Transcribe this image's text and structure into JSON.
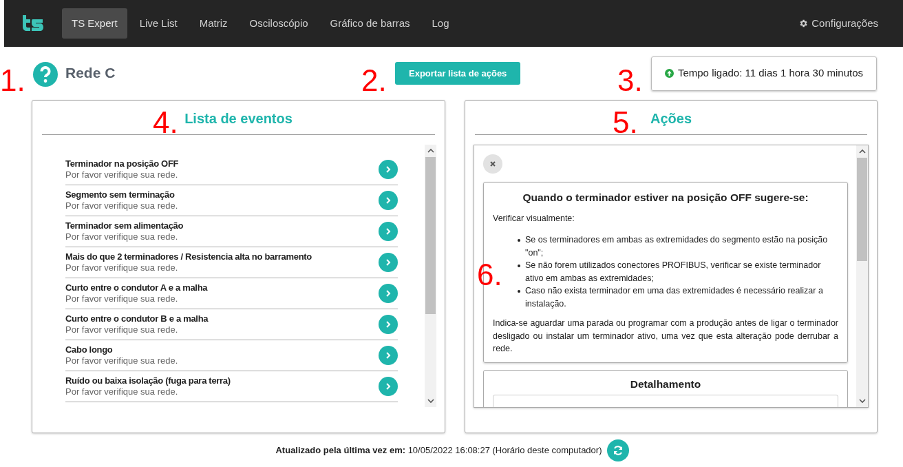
{
  "nav": {
    "items": [
      {
        "label": "TS Expert",
        "selected": true
      },
      {
        "label": "Live List",
        "selected": false
      },
      {
        "label": "Matriz",
        "selected": false
      },
      {
        "label": "Osciloscópio",
        "selected": false
      },
      {
        "label": "Gráfico de barras",
        "selected": false
      },
      {
        "label": "Log",
        "selected": false
      }
    ],
    "settings": "Configurações"
  },
  "network": {
    "annotation": "1.",
    "name": "Rede C"
  },
  "export": {
    "annotation": "2.",
    "label": "Exportar lista de ações"
  },
  "uptime": {
    "annotation": "3.",
    "text": "Tempo ligado: 11 dias 1 hora 30 minutos"
  },
  "events_panel": {
    "annotation": "4.",
    "title": "Lista de eventos",
    "events": [
      {
        "title": "Terminador na posição OFF",
        "subtitle": "Por favor verifique sua rede."
      },
      {
        "title": "Segmento sem terminação",
        "subtitle": "Por favor verifique sua rede."
      },
      {
        "title": "Terminador sem alimentação",
        "subtitle": "Por favor verifique sua rede."
      },
      {
        "title": "Mais do que 2 terminadores / Resistencia alta no barramento",
        "subtitle": "Por favor verifique sua rede."
      },
      {
        "title": "Curto entre o condutor A e a malha",
        "subtitle": "Por favor verifique sua rede."
      },
      {
        "title": "Curto entre o condutor B e a malha",
        "subtitle": "Por favor verifique sua rede."
      },
      {
        "title": "Cabo longo",
        "subtitle": "Por favor verifique sua rede."
      },
      {
        "title": "Ruído ou baixa isolação (fuga para terra)",
        "subtitle": "Por favor verifique sua rede."
      }
    ]
  },
  "actions_panel": {
    "annotation": "5.",
    "title": "Ações",
    "card": {
      "annotation": "6.",
      "title": "Quando o terminador estiver na posição OFF sugere-se:",
      "intro": "Verificar visualmente:",
      "bullets": [
        "Se os terminadores em ambas as extremidades do segmento estão na posição \"on\";",
        "Se não forem utilizados conectores PROFIBUS, verificar se existe terminador ativo em ambas as extremidades;",
        "Caso não exista terminador em uma das extremidades é necessário realizar a instalação."
      ],
      "note": "Indica-se aguardar uma parada ou programar com a produção antes de ligar o terminador desligado ou instalar um terminador ativo, uma vez que esta alteração pode derrubar a rede."
    },
    "detail_title": "Detalhamento"
  },
  "footer": {
    "text": "**Atualizado pela última vez em:** 10/05/2022 16:08:27 (Horário deste computador)"
  }
}
